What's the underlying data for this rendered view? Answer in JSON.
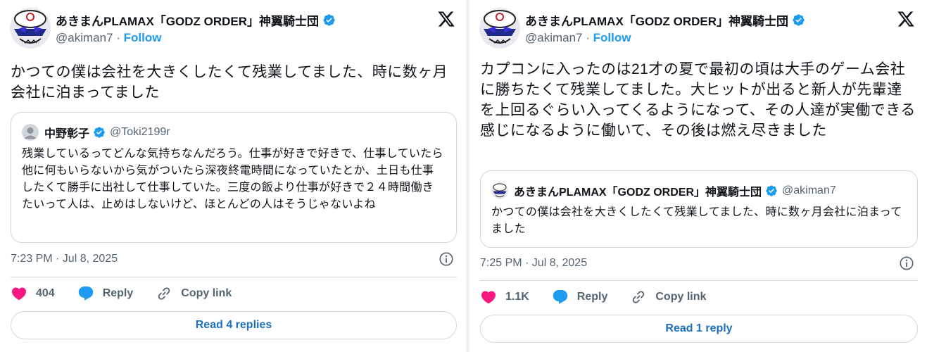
{
  "tweets": [
    {
      "author": {
        "name": "あきまんPLAMAX「GODZ ORDER」神翼騎士団",
        "handle": "@akiman7",
        "follow_label": "Follow"
      },
      "text": "かつての僕は会社を大きくしたくて残業してました、時に数ヶ月会社に泊まってました",
      "quote": {
        "author_name": "中野彰子",
        "author_handle": "@Toki2199r",
        "text": "残業しているってどんな気持ちなんだろう。仕事が好きで好きで、仕事していたら他に何もいらないから気がついたら深夜終電時間になっていたとか、土日も仕事したくて勝手に出社して仕事していた。三度の飯より仕事が好きで２４時間働きたいって人は、止めはしないけど、ほとんどの人はそうじゃないよね"
      },
      "timestamp": "7:23 PM · Jul 8, 2025",
      "likes": "404",
      "reply_label": "Reply",
      "copy_link_label": "Copy link",
      "read_replies_label": "Read 4 replies"
    },
    {
      "author": {
        "name": "あきまんPLAMAX「GODZ ORDER」神翼騎士団",
        "handle": "@akiman7",
        "follow_label": "Follow"
      },
      "text": "カプコンに入ったのは21才の夏で最初の頃は大手のゲーム会社に勝ちたくて残業してました。大ヒットが出ると新人が先輩達を上回るぐらい入ってくるようになって、その人達が実働できる感じになるように働いて、その後は燃え尽きました",
      "quote": {
        "author_name": "あきまんPLAMAX「GODZ ORDER」神翼騎士団",
        "author_handle": "@akiman7",
        "text": "かつての僕は会社を大きくしたくて残業してました、時に数ヶ月会社に泊まってました"
      },
      "timestamp": "7:25 PM · Jul 8, 2025",
      "likes": "1.1K",
      "reply_label": "Reply",
      "copy_link_label": "Copy link",
      "read_replies_label": "Read 1 reply"
    }
  ],
  "colors": {
    "accent": "#1d9bf0",
    "like": "#f91880",
    "muted": "#536471",
    "border": "#cfd9de"
  }
}
